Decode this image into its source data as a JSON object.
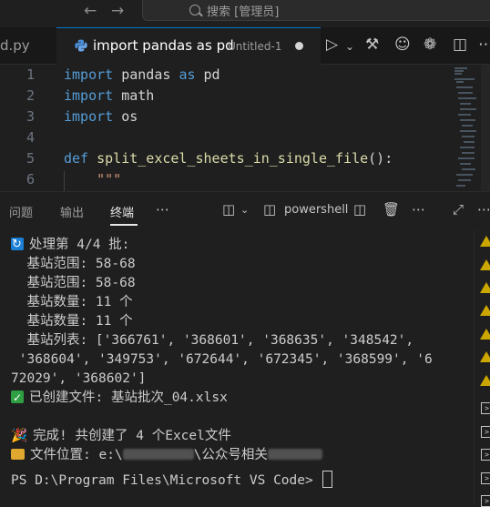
{
  "titlebar": {
    "back_icon": "arrow-left-icon",
    "forward_icon": "arrow-right-icon",
    "search_placeholder": "搜索 [管理员]"
  },
  "tabs": {
    "previous_tab_label": "d.py",
    "active_tab": {
      "icon": "python-icon",
      "title": "import pandas as pd",
      "description": "Untitled-1"
    },
    "actions": [
      "run-icon",
      "chevron-down-icon",
      "hammer-icon",
      "copilot-icon",
      "openai-icon",
      "split-editor-icon",
      "more-icon"
    ]
  },
  "editor": {
    "lines": [
      {
        "num": "1",
        "tokens": [
          {
            "t": "import",
            "c": "kw"
          },
          {
            "t": " pandas ",
            "c": "id"
          },
          {
            "t": "as",
            "c": "kw"
          },
          {
            "t": " pd",
            "c": "id"
          }
        ]
      },
      {
        "num": "2",
        "tokens": [
          {
            "t": "import",
            "c": "kw"
          },
          {
            "t": " math",
            "c": "id"
          }
        ]
      },
      {
        "num": "3",
        "tokens": [
          {
            "t": "import",
            "c": "kw"
          },
          {
            "t": " os",
            "c": "id"
          }
        ]
      },
      {
        "num": "4",
        "tokens": []
      },
      {
        "num": "5",
        "tokens": [
          {
            "t": "def",
            "c": "kw"
          },
          {
            "t": " ",
            "c": "id"
          },
          {
            "t": "split_excel_sheets_in_single_file",
            "c": "fn"
          },
          {
            "t": "():",
            "c": "id"
          }
        ]
      },
      {
        "num": "6",
        "tokens": [
          {
            "t": "    \"\"\"",
            "c": "str"
          }
        ]
      }
    ]
  },
  "panel": {
    "tabs": [
      "问题",
      "输出",
      "终端"
    ],
    "active_tab": "终端",
    "shell_name": "powershell"
  },
  "terminal": {
    "lines": [
      {
        "icon": "refresh",
        "text": "处理第 4/4 批:"
      },
      {
        "text": "  基站范围: 58-68"
      },
      {
        "text": "  基站范围: 58-68"
      },
      {
        "text": "  基站数量: 11 个"
      },
      {
        "text": "  基站数量: 11 个"
      },
      {
        "text": "  基站列表: ['366761', '368601', '368635', '348542',"
      },
      {
        "text": " '368604', '349753', '672644', '672345', '368599', '6"
      },
      {
        "text": "72029', '368602']"
      },
      {
        "icon": "check",
        "text": "已创建文件: 基站批次_04.xlsx"
      },
      {
        "text": ""
      },
      {
        "icon": "party",
        "text": "完成! 共创建了 4 个Excel文件"
      },
      {
        "icon": "folder",
        "text": "文件位置: e:\\",
        "redacted_after": true,
        "text2": "\\公众号相关"
      },
      {
        "prompt": "PS D:\\Program Files\\Microsoft VS Code> "
      }
    ]
  }
}
